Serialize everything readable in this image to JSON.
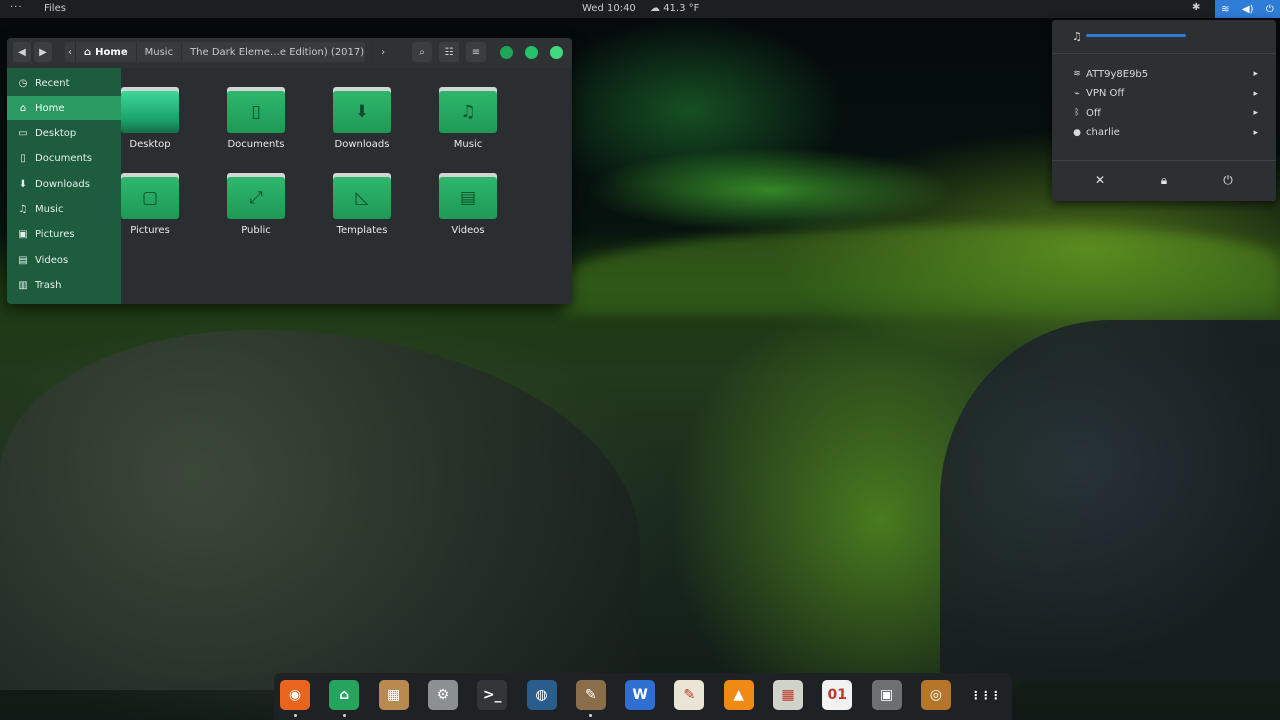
{
  "topbar": {
    "activities": "···",
    "app_name": "Files",
    "clock": "Wed 10:40",
    "weather_icon": "cloud-icon",
    "weather": "41.3 °F",
    "status_icons": [
      "network-icon",
      "volume-icon",
      "power-icon"
    ]
  },
  "file_manager": {
    "breadcrumbs": [
      "Home",
      "Music",
      "The Dark Eleme…e Edition) (2017)"
    ],
    "toolbar_icons": [
      "back-icon",
      "forward-icon",
      "search-icon",
      "list-view-icon",
      "menu-icon"
    ],
    "window_buttons": [
      "minimize",
      "maximize",
      "close"
    ],
    "accent_color": "#1e5c3e",
    "sidebar": [
      {
        "label": "Recent",
        "icon": "clock-icon",
        "glyph": "◷"
      },
      {
        "label": "Home",
        "icon": "home-icon",
        "glyph": "⌂",
        "active": true
      },
      {
        "label": "Desktop",
        "icon": "desktop-icon",
        "glyph": "▭"
      },
      {
        "label": "Documents",
        "icon": "document-icon",
        "glyph": "▯"
      },
      {
        "label": "Downloads",
        "icon": "download-icon",
        "glyph": "⬇"
      },
      {
        "label": "Music",
        "icon": "music-icon",
        "glyph": "♫"
      },
      {
        "label": "Pictures",
        "icon": "picture-icon",
        "glyph": "▣"
      },
      {
        "label": "Videos",
        "icon": "video-icon",
        "glyph": "▤"
      },
      {
        "label": "Trash",
        "icon": "trash-icon",
        "glyph": "▥"
      }
    ],
    "folders": [
      {
        "label": "Desktop",
        "icon": "desktop-folder-icon",
        "glyph": ""
      },
      {
        "label": "Documents",
        "icon": "documents-folder-icon",
        "glyph": "▯"
      },
      {
        "label": "Downloads",
        "icon": "downloads-folder-icon",
        "glyph": "⬇"
      },
      {
        "label": "Music",
        "icon": "music-folder-icon",
        "glyph": "♫"
      },
      {
        "label": "Pictures",
        "icon": "pictures-folder-icon",
        "glyph": "▢"
      },
      {
        "label": "Public",
        "icon": "public-folder-icon",
        "glyph": "⤢"
      },
      {
        "label": "Templates",
        "icon": "templates-folder-icon",
        "glyph": "◺"
      },
      {
        "label": "Videos",
        "icon": "videos-folder-icon",
        "glyph": "▤"
      }
    ]
  },
  "system_menu": {
    "volume_icon": "headphones-icon",
    "items": [
      {
        "label": "ATT9y8E9b5",
        "icon": "wifi-icon",
        "glyph": "≋"
      },
      {
        "label": "VPN Off",
        "icon": "vpn-icon",
        "glyph": "⌁"
      },
      {
        "label": "Off",
        "icon": "bluetooth-icon",
        "glyph": "ᛒ"
      },
      {
        "label": "charlie",
        "icon": "user-icon",
        "glyph": "●"
      }
    ],
    "actions": [
      "settings-icon",
      "lock-icon",
      "power-icon"
    ]
  },
  "dock": {
    "apps": [
      {
        "name": "firefox",
        "color": "#e8641f",
        "glyph": "◉",
        "running": true
      },
      {
        "name": "files",
        "color": "#26a35c",
        "glyph": "⌂",
        "running": true
      },
      {
        "name": "archive-manager",
        "color": "#b98a4f",
        "glyph": "▦",
        "running": false
      },
      {
        "name": "system-settings",
        "color": "#8b9090",
        "glyph": "⚙",
        "running": false
      },
      {
        "name": "terminal",
        "color": "#333639",
        "glyph": ">_",
        "running": false
      },
      {
        "name": "web-browser",
        "color": "#2a5d8c",
        "glyph": "◍",
        "running": false
      },
      {
        "name": "gimp",
        "color": "#8a6e4a",
        "glyph": "✎",
        "running": true
      },
      {
        "name": "word-processor",
        "color": "#2f6fd1",
        "glyph": "W",
        "running": false
      },
      {
        "name": "text-editor",
        "color": "#e9e4d4",
        "glyph": "✎",
        "running": false
      },
      {
        "name": "vlc",
        "color": "#f08a14",
        "glyph": "▲",
        "running": false
      },
      {
        "name": "calculator",
        "color": "#cfd3c8",
        "glyph": "▦",
        "running": false
      },
      {
        "name": "calendar",
        "color": "#f2f2f2",
        "glyph": "01",
        "running": false
      },
      {
        "name": "screenshot",
        "color": "#6c7072",
        "glyph": "▣",
        "running": false
      },
      {
        "name": "sound",
        "color": "#b5762c",
        "glyph": "◎",
        "running": false
      },
      {
        "name": "show-applications",
        "color": "#1e2224",
        "glyph": "⋮⋮⋮",
        "running": false
      }
    ]
  }
}
